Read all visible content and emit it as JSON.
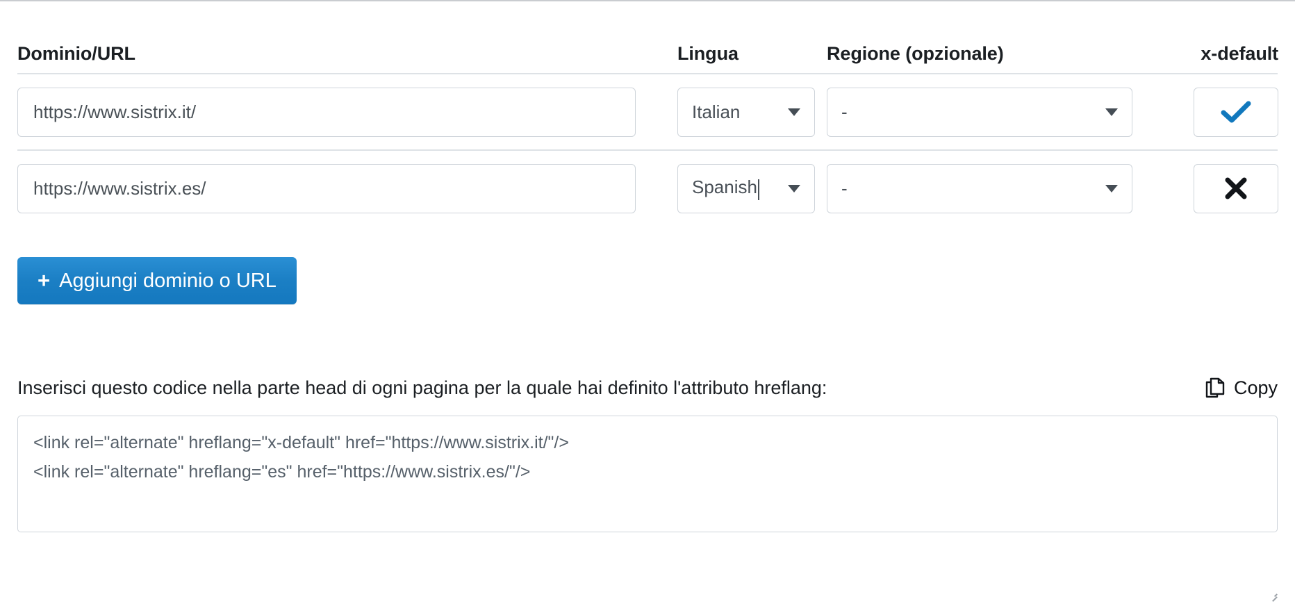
{
  "table": {
    "headers": {
      "domain": "Dominio/URL",
      "language": "Lingua",
      "region": "Regione (opzionale)",
      "xdefault": "x-default"
    },
    "rows": [
      {
        "url": "https://www.sistrix.it/",
        "url_placeholder": "https://www.sistrix.it/",
        "language": "Italian",
        "region": "-",
        "xdefault_icon": "check-icon",
        "xdefault_selected": "true"
      },
      {
        "url": "https://www.sistrix.es/",
        "url_placeholder": "https://www.sistrix.es/",
        "language": "Spanish",
        "region": "-",
        "xdefault_icon": "close-icon",
        "xdefault_selected": "false"
      }
    ]
  },
  "actions": {
    "add_label": "Aggiungi dominio o URL",
    "add_plus": "+"
  },
  "snippet": {
    "hint": "Inserisci questo codice nella parte head di ogni pagina per la quale hai definito l'attributo hreflang:",
    "copy_label": "Copy",
    "code": "<link rel=\"alternate\" hreflang=\"x-default\" href=\"https://www.sistrix.it/\"/>\n<link rel=\"alternate\" hreflang=\"es\" href=\"https://www.sistrix.es/\"/>"
  },
  "colors": {
    "accent": "#1b7fc4",
    "check": "#1178bd",
    "border": "#ced4da",
    "separator": "#dee2e6",
    "text": "#212529",
    "code_text": "#56606a"
  }
}
